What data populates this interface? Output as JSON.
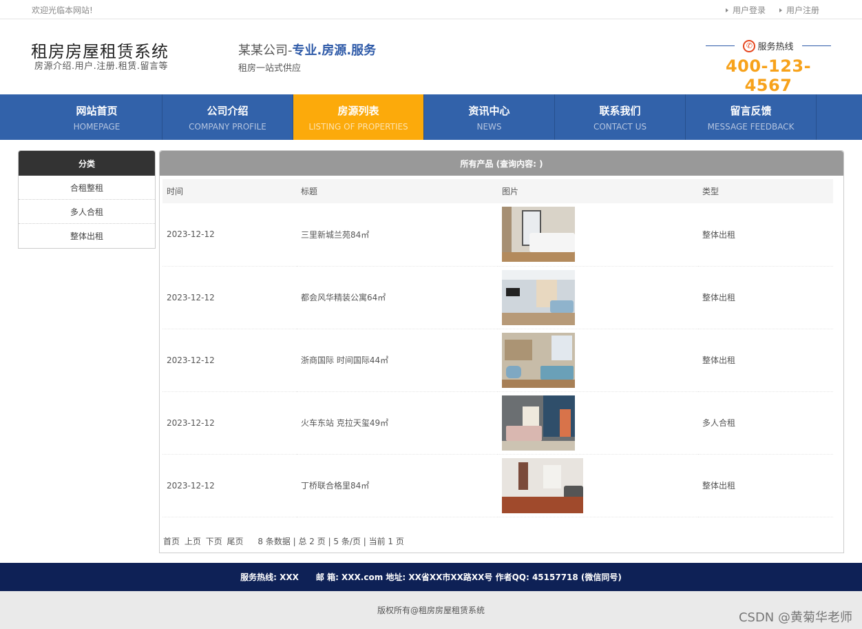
{
  "topbar": {
    "welcome": "欢迎光临本网站!",
    "login": "用户登录",
    "register": "用户注册"
  },
  "header": {
    "title": "租房房屋租赁系统",
    "subtitle": "房源介绍.用户.注册.租赁.留言等",
    "slogan_prefix": "某某公司-",
    "slogan_strong": "专业.房源.服务",
    "slogan_sub": "租房一站式供应",
    "hotline_label": "服务热线",
    "hotline_number": "400-123-4567"
  },
  "nav": [
    {
      "cn": "网站首页",
      "en": "HOMEPAGE"
    },
    {
      "cn": "公司介绍",
      "en": "COMPANY PROFILE"
    },
    {
      "cn": "房源列表",
      "en": "LISTING OF PROPERTIES"
    },
    {
      "cn": "资讯中心",
      "en": "NEWS"
    },
    {
      "cn": "联系我们",
      "en": "CONTACT US"
    },
    {
      "cn": "留言反馈",
      "en": "MESSAGE FEEDBACK"
    }
  ],
  "sidebar": {
    "heading": "分类",
    "categories": [
      "合租整租",
      "多人合租",
      "整体出租"
    ]
  },
  "content": {
    "heading": "所有产品 (查询内容: )",
    "columns": [
      "时间",
      "标题",
      "图片",
      "类型"
    ],
    "rows": [
      {
        "time": "2023-12-12",
        "title": "三里新城兰苑84㎡",
        "type": "整体出租",
        "image": "bedroom-photo"
      },
      {
        "time": "2023-12-12",
        "title": "都会风华精装公寓64㎡",
        "type": "整体出租",
        "image": "living-room-photo"
      },
      {
        "time": "2023-12-12",
        "title": "浙商国际 时间国际44㎡",
        "type": "整体出租",
        "image": "studio-photo"
      },
      {
        "time": "2023-12-12",
        "title": "火车东站 克拉天玺49㎡",
        "type": "多人合租",
        "image": "bedroom-photo"
      },
      {
        "time": "2023-12-12",
        "title": "丁桥联合格里84㎡",
        "type": "整体出租",
        "image": "living-room-photo"
      }
    ],
    "pager": {
      "first": "首页",
      "prev": "上页",
      "next": "下页",
      "last": "尾页",
      "info": "8 条数据 | 总 2 页 | 5 条/页 | 当前 1 页"
    }
  },
  "footer": {
    "contact": "服务热线: XXX      邮 箱: XXX.com 地址: XX省XX市XX路XX号 作者QQ: 45157718 (微信同号)",
    "copyright": "版权所有@租房房屋租赁系统"
  },
  "watermark": "CSDN @黄菊华老师",
  "colors": {
    "nav_bg": "#3262aa",
    "nav_active": "#fcaa0b",
    "footer_bg": "#0e2156",
    "hotline": "#f7a21b",
    "slogan_accent": "#2e5aa8"
  }
}
